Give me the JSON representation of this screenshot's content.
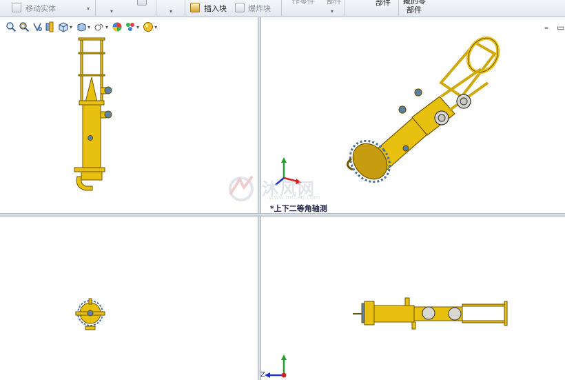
{
  "ribbon": {
    "move_body": "移动实体",
    "insert_block": "插入块",
    "explode_block": "爆炸块",
    "partial_1": "作零件",
    "partial_2": "部件",
    "partial_3": "部件",
    "partial_4": "藏的零",
    "partial_5": "部件"
  },
  "viewports": {
    "top_right_label": "*上下二等角轴测"
  },
  "watermark": {
    "brand": "沐风网",
    "url": "www.mfcad.com"
  },
  "triad": {
    "z_label": "Z"
  },
  "colors": {
    "model_yellow": "#e8c010",
    "model_outline": "#6b5400",
    "flange_blue": "#5a7fa8",
    "axis_x": "#d42020",
    "axis_y": "#20a030",
    "axis_z": "#2030c8"
  },
  "icons": {
    "hud": [
      "zoom-to-fit-icon",
      "zoom-area-icon",
      "previous-view-icon",
      "section-view-icon",
      "view-orientation-icon",
      "display-style-icon",
      "hide-show-icon",
      "edit-appearance-icon",
      "apply-scene-icon",
      "view-settings-icon"
    ]
  }
}
